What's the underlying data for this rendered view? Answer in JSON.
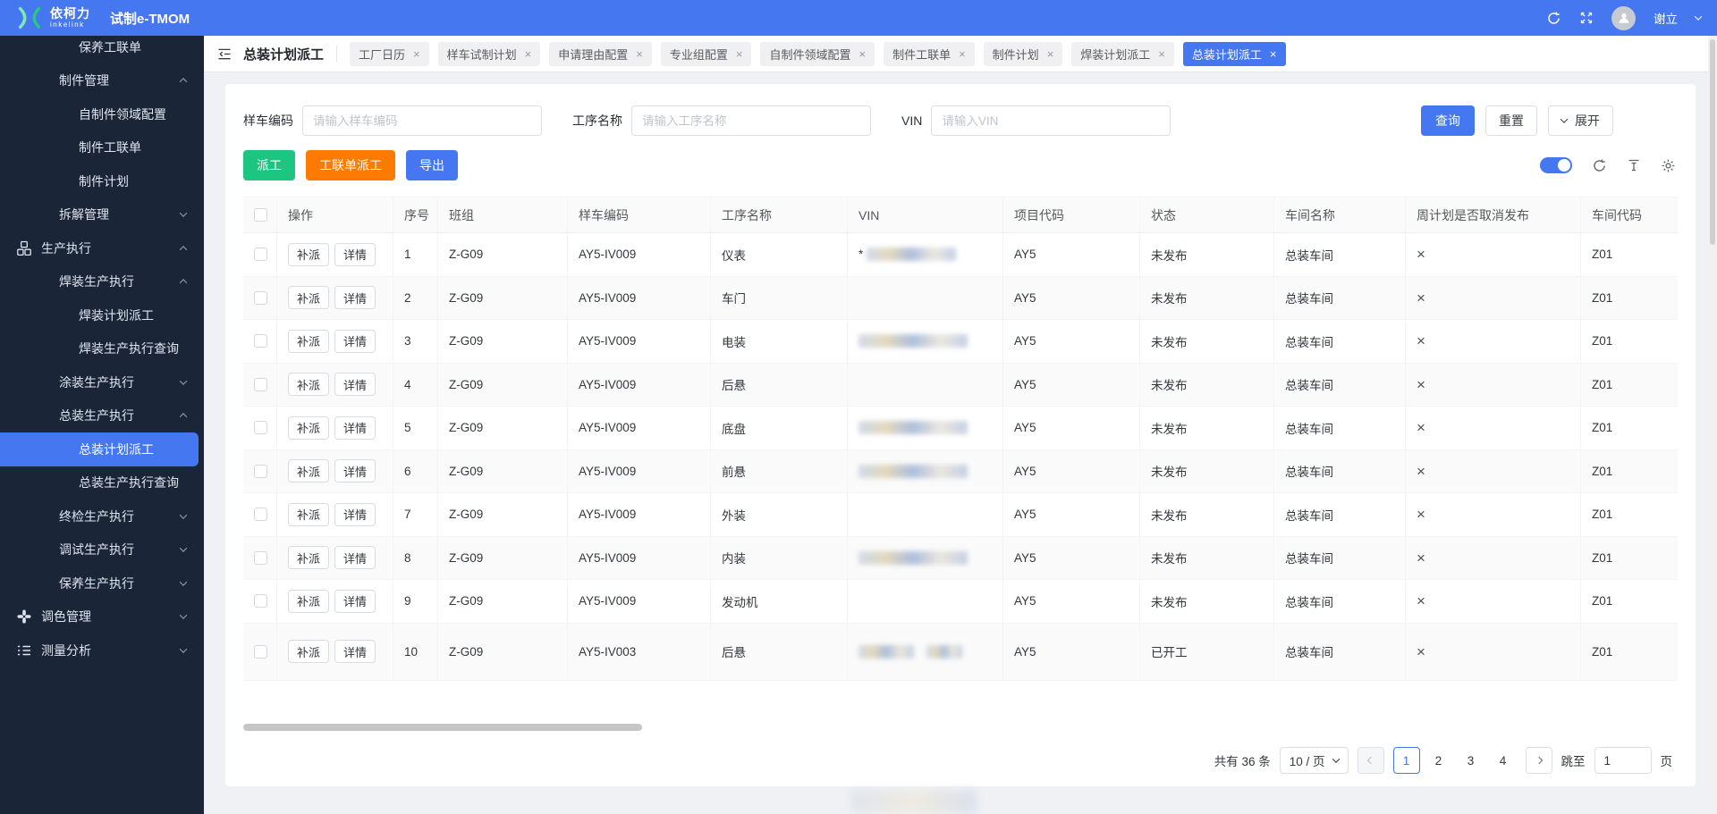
{
  "colors": {
    "primary": "#4577F0",
    "green": "#1CC580",
    "orange": "#FF7A00",
    "sidebar_bg": "#1B2538",
    "header_bg": "#4577F0"
  },
  "header": {
    "brand_cn": "依柯力",
    "brand_en": "inkelink",
    "app_title": "试制e-TMOM",
    "user_name": "谢立"
  },
  "sidebar": {
    "items": [
      {
        "label": "保养工联单",
        "level": 3
      },
      {
        "label": "制件管理",
        "level": 2,
        "chevron": "up"
      },
      {
        "label": "自制件领域配置",
        "level": 3
      },
      {
        "label": "制件工联单",
        "level": 3
      },
      {
        "label": "制件计划",
        "level": 3
      },
      {
        "label": "拆解管理",
        "level": 2,
        "chevron": "down"
      },
      {
        "label": "生产执行",
        "level": 1,
        "icon": "cubes-icon",
        "chevron": "up"
      },
      {
        "label": "焊装生产执行",
        "level": 2,
        "chevron": "up"
      },
      {
        "label": "焊装计划派工",
        "level": 3
      },
      {
        "label": "焊装生产执行查询",
        "level": 3
      },
      {
        "label": "涂装生产执行",
        "level": 2,
        "chevron": "down"
      },
      {
        "label": "总装生产执行",
        "level": 2,
        "chevron": "up"
      },
      {
        "label": "总装计划派工",
        "level": 3,
        "active": true
      },
      {
        "label": "总装生产执行查询",
        "level": 3
      },
      {
        "label": "终检生产执行",
        "level": 2,
        "chevron": "down"
      },
      {
        "label": "调试生产执行",
        "level": 2,
        "chevron": "down"
      },
      {
        "label": "保养生产执行",
        "level": 2,
        "chevron": "down"
      },
      {
        "label": "调色管理",
        "level": 1,
        "icon": "palette-icon",
        "chevron": "down"
      },
      {
        "label": "测量分析",
        "level": 1,
        "icon": "list-icon",
        "chevron": "down"
      }
    ]
  },
  "tabbar": {
    "page_title": "总装计划派工",
    "close_glyph": "×",
    "tabs": [
      {
        "label": "工厂日历"
      },
      {
        "label": "样车试制计划"
      },
      {
        "label": "申请理由配置"
      },
      {
        "label": "专业组配置"
      },
      {
        "label": "自制件领域配置"
      },
      {
        "label": "制件工联单"
      },
      {
        "label": "制件计划"
      },
      {
        "label": "焊装计划派工"
      },
      {
        "label": "总装计划派工",
        "active": true
      }
    ]
  },
  "filters": {
    "fields": [
      {
        "label": "样车编码",
        "placeholder": "请输入样车编码"
      },
      {
        "label": "工序名称",
        "placeholder": "请输入工序名称"
      },
      {
        "label": "VIN",
        "placeholder": "请输入VIN"
      }
    ],
    "search_label": "查询",
    "reset_label": "重置",
    "expand_label": "展开"
  },
  "actions": {
    "buttons": [
      {
        "label": "派工",
        "color": "#1CC580"
      },
      {
        "label": "工联单派工",
        "color": "#FF7A00"
      },
      {
        "label": "导出",
        "color": "#4577F0"
      }
    ],
    "toggle_on": true
  },
  "table": {
    "op_buttons": [
      "补派",
      "详情"
    ],
    "columns": [
      {
        "key": "select",
        "label": ""
      },
      {
        "key": "op",
        "label": "操作"
      },
      {
        "key": "seq",
        "label": "序号"
      },
      {
        "key": "team",
        "label": "班组"
      },
      {
        "key": "sample",
        "label": "样车编码"
      },
      {
        "key": "process",
        "label": "工序名称"
      },
      {
        "key": "vin",
        "label": "VIN"
      },
      {
        "key": "project",
        "label": "项目代码"
      },
      {
        "key": "status",
        "label": "状态"
      },
      {
        "key": "workshop",
        "label": "车间名称"
      },
      {
        "key": "week_cancel",
        "label": "周计划是否取消发布"
      },
      {
        "key": "wcode",
        "label": "车间代码"
      }
    ],
    "rows": [
      {
        "seq": "1",
        "team": "Z-G09",
        "sample": "AY5-IV009",
        "process": "仪表",
        "vin_blurred": true,
        "vin_star": "*",
        "project": "AY5",
        "status": "未发布",
        "workshop": "总装车间",
        "week_cancel": "×",
        "wcode": "Z01"
      },
      {
        "seq": "2",
        "team": "Z-G09",
        "sample": "AY5-IV009",
        "process": "车门",
        "vin_blurred": false,
        "project": "AY5",
        "status": "未发布",
        "workshop": "总装车间",
        "week_cancel": "×",
        "wcode": "Z01"
      },
      {
        "seq": "3",
        "team": "Z-G09",
        "sample": "AY5-IV009",
        "process": "电装",
        "vin_blurred": true,
        "project": "AY5",
        "status": "未发布",
        "workshop": "总装车间",
        "week_cancel": "×",
        "wcode": "Z01"
      },
      {
        "seq": "4",
        "team": "Z-G09",
        "sample": "AY5-IV009",
        "process": "后悬",
        "vin_blurred": false,
        "project": "AY5",
        "status": "未发布",
        "workshop": "总装车间",
        "week_cancel": "×",
        "wcode": "Z01"
      },
      {
        "seq": "5",
        "team": "Z-G09",
        "sample": "AY5-IV009",
        "process": "底盘",
        "vin_blurred": true,
        "project": "AY5",
        "status": "未发布",
        "workshop": "总装车间",
        "week_cancel": "×",
        "wcode": "Z01"
      },
      {
        "seq": "6",
        "team": "Z-G09",
        "sample": "AY5-IV009",
        "process": "前悬",
        "vin_blurred": true,
        "project": "AY5",
        "status": "未发布",
        "workshop": "总装车间",
        "week_cancel": "×",
        "wcode": "Z01"
      },
      {
        "seq": "7",
        "team": "Z-G09",
        "sample": "AY5-IV009",
        "process": "外装",
        "vin_blurred": false,
        "project": "AY5",
        "status": "未发布",
        "workshop": "总装车间",
        "week_cancel": "×",
        "wcode": "Z01"
      },
      {
        "seq": "8",
        "team": "Z-G09",
        "sample": "AY5-IV009",
        "process": "内装",
        "vin_blurred": true,
        "project": "AY5",
        "status": "未发布",
        "workshop": "总装车间",
        "week_cancel": "×",
        "wcode": "Z01"
      },
      {
        "seq": "9",
        "team": "Z-G09",
        "sample": "AY5-IV009",
        "process": "发动机",
        "vin_blurred": false,
        "project": "AY5",
        "status": "未发布",
        "workshop": "总装车间",
        "week_cancel": "×",
        "wcode": "Z01"
      },
      {
        "seq": "10",
        "team": "Z-G09",
        "sample": "AY5-IV003",
        "process": "后悬",
        "vin_blurred": true,
        "vin_segments": 2,
        "tall": true,
        "project": "AY5",
        "status": "已开工",
        "workshop": "总装车间",
        "week_cancel": "×",
        "wcode": "Z01"
      }
    ]
  },
  "pagination": {
    "total_text": "共有 36 条",
    "page_size": "10 / 页",
    "pages": [
      "1",
      "2",
      "3",
      "4"
    ],
    "current_page": "1",
    "jump_label": "跳至",
    "jump_value": "1",
    "jump_unit": "页"
  }
}
